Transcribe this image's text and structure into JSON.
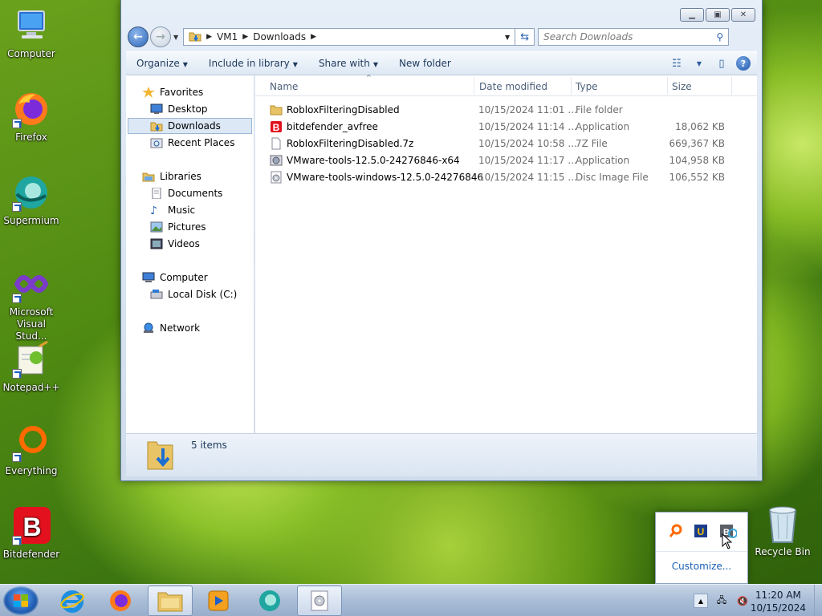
{
  "desktop": {
    "icons": [
      {
        "label": "Computer"
      },
      {
        "label": "Firefox"
      },
      {
        "label": "Supermium"
      },
      {
        "label": "Microsoft Visual Stud..."
      },
      {
        "label": "Notepad++"
      },
      {
        "label": "Everything"
      },
      {
        "label": "Bitdefender"
      }
    ],
    "recycle_bin": "Recycle Bin"
  },
  "window": {
    "address": {
      "root": "VM1",
      "folder": "Downloads"
    },
    "search_placeholder": "Search Downloads",
    "toolbar": {
      "organize": "Organize",
      "include_in_library": "Include in library",
      "share_with": "Share with",
      "new_folder": "New folder"
    },
    "nav_pane": {
      "favorites": "Favorites",
      "desktop": "Desktop",
      "downloads": "Downloads",
      "recent_places": "Recent Places",
      "libraries": "Libraries",
      "documents": "Documents",
      "music": "Music",
      "pictures": "Pictures",
      "videos": "Videos",
      "computer": "Computer",
      "local_disk": "Local Disk (C:)",
      "network": "Network"
    },
    "columns": {
      "name": "Name",
      "date": "Date modified",
      "type": "Type",
      "size": "Size"
    },
    "files": [
      {
        "name": "RobloxFilteringDisabled",
        "date": "10/15/2024 11:01 ...",
        "type": "File folder",
        "size": "",
        "icon": "folder-icon"
      },
      {
        "name": "bitdefender_avfree",
        "date": "10/15/2024 11:14 ...",
        "type": "Application",
        "size": "18,062 KB",
        "icon": "bitdefender-file-icon"
      },
      {
        "name": "RobloxFilteringDisabled.7z",
        "date": "10/15/2024 10:58 ...",
        "type": "7Z File",
        "size": "669,367 KB",
        "icon": "blank-file-icon"
      },
      {
        "name": "VMware-tools-12.5.0-24276846-x64",
        "date": "10/15/2024 11:17 ...",
        "type": "Application",
        "size": "104,958 KB",
        "icon": "installer-file-icon"
      },
      {
        "name": "VMware-tools-windows-12.5.0-24276846",
        "date": "10/15/2024 11:15 ...",
        "type": "Disc Image File",
        "size": "106,552 KB",
        "icon": "disc-image-icon"
      }
    ],
    "status": {
      "count": "5 items"
    }
  },
  "tray_popup": {
    "customize": "Customize..."
  },
  "taskbar": {
    "time": "11:20 AM",
    "date": "10/15/2024"
  }
}
